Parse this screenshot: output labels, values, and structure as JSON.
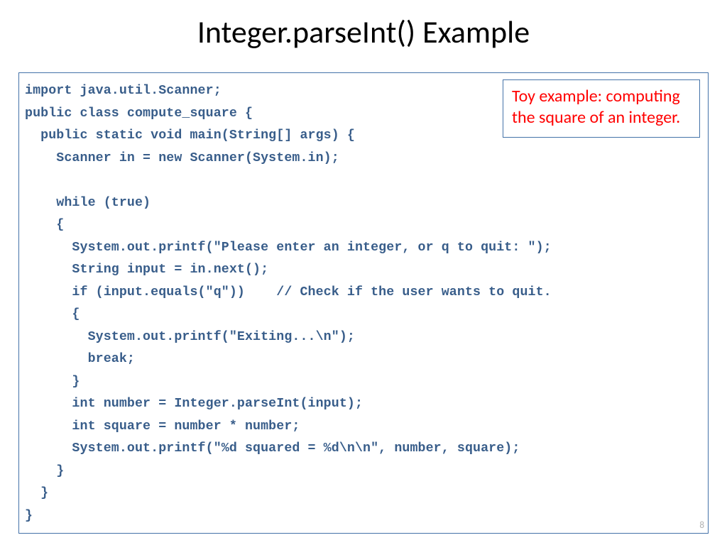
{
  "title": "Integer.parseInt() Example",
  "annotation": "Toy example: computing the square of an integer.",
  "page_number": "8",
  "code": "import java.util.Scanner;\npublic class compute_square {\n  public static void main(String[] args) {\n    Scanner in = new Scanner(System.in);\n\n    while (true)\n    {\n      System.out.printf(\"Please enter an integer, or q to quit: \");\n      String input = in.next();\n      if (input.equals(\"q\"))    // Check if the user wants to quit.\n      {\n        System.out.printf(\"Exiting...\\n\");\n        break;\n      }\n      int number = Integer.parseInt(input);\n      int square = number * number;\n      System.out.printf(\"%d squared = %d\\n\\n\", number, square);\n    }\n  }\n}"
}
